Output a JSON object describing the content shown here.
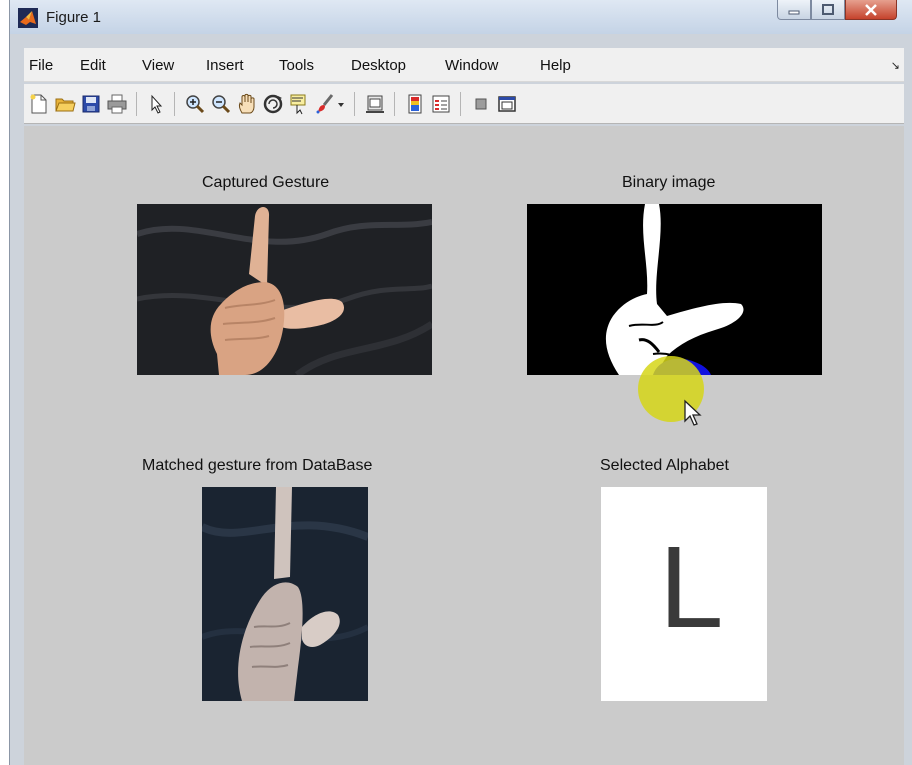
{
  "window": {
    "title": "Figure 1"
  },
  "menu": [
    "File",
    "Edit",
    "View",
    "Insert",
    "Tools",
    "Desktop",
    "Window",
    "Help"
  ],
  "toolbar_icons": [
    "new-figure-icon",
    "open-file-icon",
    "save-icon",
    "print-icon",
    "pointer-icon",
    "zoom-in-icon",
    "zoom-out-icon",
    "pan-icon",
    "rotate-3d-icon",
    "data-cursor-icon",
    "brush-icon",
    "brush-dropdown-icon",
    "link-plot-icon",
    "colorbar-icon",
    "legend-icon",
    "hide-plot-tools-icon",
    "show-plot-tools-icon"
  ],
  "panels": {
    "captured": {
      "label": "Captured Gesture"
    },
    "binary": {
      "label": "Binary image"
    },
    "matched": {
      "label": "Matched gesture from DataBase"
    },
    "selected": {
      "label": "Selected Alphabet",
      "letter": "L"
    }
  },
  "colors": {
    "figure_bg": "#cbcbcb",
    "cursor_halo": "#d6d618",
    "binary_blob": "#1010e0"
  }
}
